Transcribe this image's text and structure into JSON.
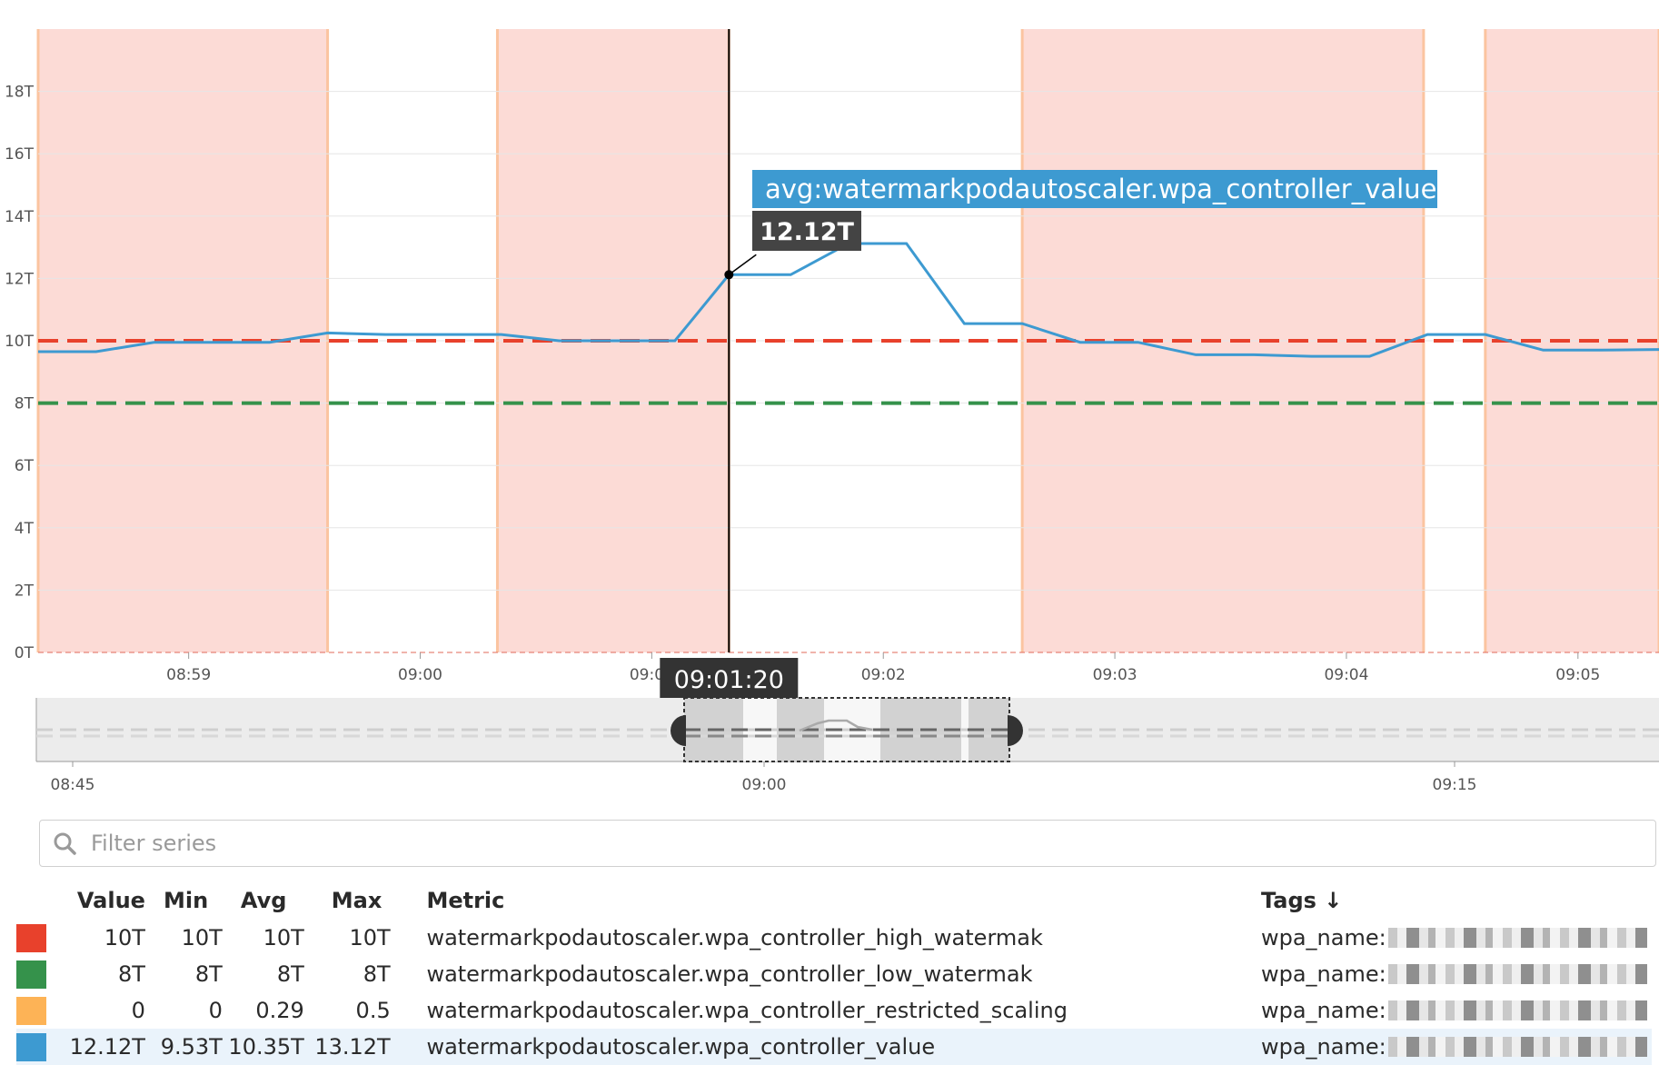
{
  "chart_data": {
    "type": "line",
    "ylim": [
      0,
      20
    ],
    "yticks": [
      "0T",
      "2T",
      "4T",
      "6T",
      "8T",
      "10T",
      "12T",
      "14T",
      "16T",
      "18T"
    ],
    "xticks": [
      "08:59",
      "09:00",
      "09:01",
      "09:02",
      "09:03",
      "09:04",
      "09:05"
    ],
    "restricted_scaling_bands": [
      [
        "08:58:21",
        "08:59:36"
      ],
      [
        "09:00:20",
        "09:01:20"
      ],
      [
        "09:02:36",
        "09:04:20"
      ],
      [
        "09:04:36",
        "09:05:21"
      ]
    ],
    "series": [
      {
        "name": "watermarkpodautoscaler.wpa_controller_high_watermak",
        "color": "#e8412c",
        "style": "dashed",
        "x": [
          "08:58:21",
          "09:05:21"
        ],
        "y": [
          10,
          10
        ]
      },
      {
        "name": "watermarkpodautoscaler.wpa_controller_low_watermak",
        "color": "#35924b",
        "style": "dashed",
        "x": [
          "08:58:21",
          "09:05:21"
        ],
        "y": [
          8,
          8
        ]
      },
      {
        "name": "watermarkpodautoscaler.wpa_controller_value",
        "color": "#3d9ad1",
        "style": "solid",
        "x": [
          "08:58:21",
          "08:58:36",
          "08:58:51",
          "08:59:06",
          "08:59:21",
          "08:59:36",
          "08:59:51",
          "09:00:06",
          "09:00:21",
          "09:00:36",
          "09:00:51",
          "09:01:06",
          "09:01:20",
          "09:01:36",
          "09:01:51",
          "09:02:06",
          "09:02:21",
          "09:02:36",
          "09:02:51",
          "09:03:06",
          "09:03:21",
          "09:03:36",
          "09:03:51",
          "09:04:06",
          "09:04:21",
          "09:04:36",
          "09:04:51",
          "09:05:06",
          "09:05:21"
        ],
        "y": [
          9.65,
          9.65,
          9.95,
          9.95,
          9.95,
          10.25,
          10.2,
          10.2,
          10.2,
          10.0,
          10.0,
          10.0,
          12.12,
          12.12,
          13.12,
          13.12,
          10.55,
          10.55,
          9.95,
          9.95,
          9.55,
          9.55,
          9.5,
          9.5,
          10.2,
          10.2,
          9.7,
          9.7,
          9.72
        ]
      }
    ],
    "tooltip": {
      "metric": "avg:watermarkpodautoscaler.wpa_controller_value",
      "value": "12.12T",
      "time": "09:01:20"
    },
    "navigator": {
      "ticks": [
        "08:45",
        "09:00",
        "09:15"
      ]
    }
  },
  "filter": {
    "placeholder": "Filter series"
  },
  "legend": {
    "headers": {
      "value": "Value",
      "min": "Min",
      "avg": "Avg",
      "max": "Max",
      "metric": "Metric",
      "tags": "Tags ↓"
    },
    "rows": [
      {
        "color": "#e8412c",
        "value": "10T",
        "min": "10T",
        "avg": "10T",
        "max": "10T",
        "metric": "watermarkpodautoscaler.wpa_controller_high_watermak",
        "tag": "wpa_name:"
      },
      {
        "color": "#35924b",
        "value": "8T",
        "min": "8T",
        "avg": "8T",
        "max": "8T",
        "metric": "watermarkpodautoscaler.wpa_controller_low_watermak",
        "tag": "wpa_name:"
      },
      {
        "color": "#fdb356",
        "value": "0",
        "min": "0",
        "avg": "0.29",
        "max": "0.5",
        "metric": "watermarkpodautoscaler.wpa_controller_restricted_scaling",
        "tag": "wpa_name:"
      },
      {
        "color": "#3d9ad1",
        "value": "12.12T",
        "min": "9.53T",
        "avg": "10.35T",
        "max": "13.12T",
        "metric": "watermarkpodautoscaler.wpa_controller_value",
        "tag": "wpa_name:"
      }
    ]
  }
}
